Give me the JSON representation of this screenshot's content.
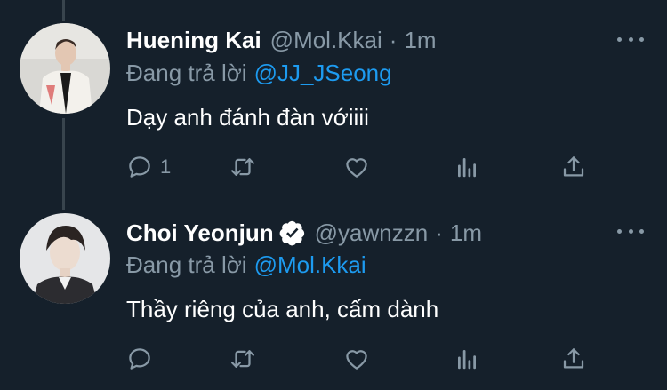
{
  "tweets": [
    {
      "name": "Huening Kai",
      "handle": "@Mol.Kkai",
      "separator": "·",
      "time": "1m",
      "replying_prefix": "Đang trả lời",
      "replying_to": "@JJ_JSeong",
      "text": "Dạy anh đánh đàn vớiiii",
      "reply_count": "1",
      "verified": false
    },
    {
      "name": "Choi Yeonjun",
      "handle": "@yawnzzn",
      "separator": "·",
      "time": "1m",
      "replying_prefix": "Đang trả lời",
      "replying_to": "@Mol.Kkai",
      "text": "Thầy riêng của anh, cấm dành",
      "reply_count": "",
      "verified": true
    }
  ],
  "colors": {
    "background": "#15202b",
    "text_primary": "#ffffff",
    "text_secondary": "#8899a6",
    "mention": "#1d9bf0",
    "thread_line": "#38444d"
  },
  "icons": [
    "reply-icon",
    "retweet-icon",
    "like-icon",
    "analytics-icon",
    "share-icon",
    "more-icon",
    "verified-badge-icon"
  ]
}
